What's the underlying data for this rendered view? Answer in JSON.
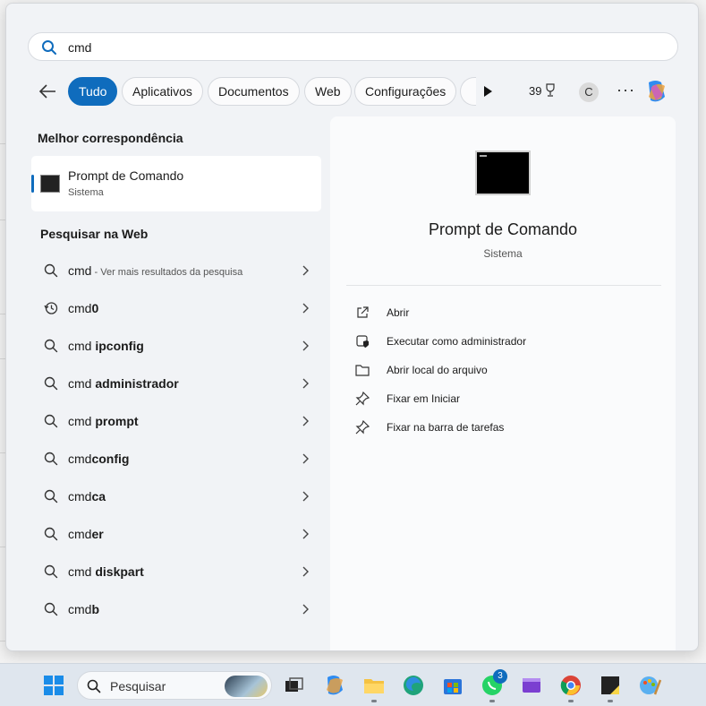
{
  "search": {
    "query": "cmd"
  },
  "filters": {
    "tabs": [
      {
        "label": "Tudo",
        "active": true
      },
      {
        "label": "Aplicativos",
        "active": false
      },
      {
        "label": "Documentos",
        "active": false
      },
      {
        "label": "Web",
        "active": false
      },
      {
        "label": "Configurações",
        "active": false
      }
    ],
    "points": "39",
    "avatar_initial": "C",
    "more": "···"
  },
  "best_match": {
    "title": "Melhor correspondência",
    "name": "Prompt de Comando",
    "subtitle": "Sistema"
  },
  "web": {
    "title": "Pesquisar na Web",
    "items": [
      {
        "icon": "search-icon",
        "prefix": "cmd",
        "bold": "",
        "hint": " - Ver mais resultados da pesquisa"
      },
      {
        "icon": "history-icon",
        "prefix": "cmd",
        "bold": "0",
        "hint": ""
      },
      {
        "icon": "search-icon",
        "prefix": "cmd ",
        "bold": "ipconfig",
        "hint": ""
      },
      {
        "icon": "search-icon",
        "prefix": "cmd ",
        "bold": "administrador",
        "hint": ""
      },
      {
        "icon": "search-icon",
        "prefix": "cmd ",
        "bold": "prompt",
        "hint": ""
      },
      {
        "icon": "search-icon",
        "prefix": "cmd",
        "bold": "config",
        "hint": ""
      },
      {
        "icon": "search-icon",
        "prefix": "cmd",
        "bold": "ca",
        "hint": ""
      },
      {
        "icon": "search-icon",
        "prefix": "cmd",
        "bold": "er",
        "hint": ""
      },
      {
        "icon": "search-icon",
        "prefix": "cmd ",
        "bold": "diskpart",
        "hint": ""
      },
      {
        "icon": "search-icon",
        "prefix": "cmd",
        "bold": "b",
        "hint": ""
      }
    ]
  },
  "detail": {
    "title": "Prompt de Comando",
    "subtitle": "Sistema",
    "actions": [
      {
        "icon": "open-icon",
        "label": "Abrir"
      },
      {
        "icon": "admin-shield-icon",
        "label": "Executar como administrador"
      },
      {
        "icon": "folder-icon",
        "label": "Abrir local do arquivo"
      },
      {
        "icon": "pin-icon",
        "label": "Fixar em Iniciar"
      },
      {
        "icon": "pin-icon",
        "label": "Fixar na barra de tarefas"
      }
    ]
  },
  "taskbar": {
    "search_placeholder": "Pesquisar",
    "whatsapp_badge": "3"
  },
  "colors": {
    "accent": "#0f6cbd"
  }
}
